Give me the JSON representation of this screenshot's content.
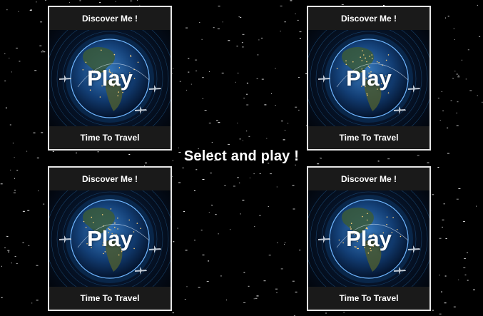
{
  "caption": "Select and play !",
  "cards": [
    {
      "header": "Discover Me !",
      "play": "Play",
      "footer": "Time To Travel"
    },
    {
      "header": "Discover Me !",
      "play": "Play",
      "footer": "Time To Travel"
    },
    {
      "header": "Discover Me !",
      "play": "Play",
      "footer": "Time To Travel"
    },
    {
      "header": "Discover Me !",
      "play": "Play",
      "footer": "Time To Travel"
    }
  ]
}
